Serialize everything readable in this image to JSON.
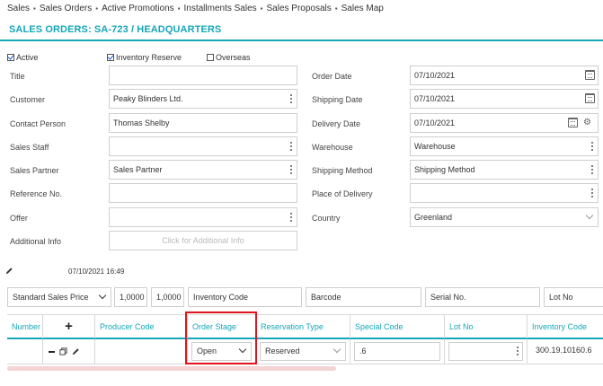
{
  "nav": {
    "items": [
      "Sales",
      "Sales Orders",
      "Active Promotions",
      "Installments Sales",
      "Sales Proposals",
      "Sales Map"
    ],
    "separator": "▪"
  },
  "page": {
    "title": "SALES ORDERS: SA-723 / HEADQUARTERS"
  },
  "checkboxes": {
    "active": {
      "label": "Active",
      "checked": true
    },
    "inventory_reserve": {
      "label": "Inventory Reserve",
      "checked": true
    },
    "overseas": {
      "label": "Overseas",
      "checked": false
    }
  },
  "left_form": {
    "title": {
      "label": "Title",
      "value": ""
    },
    "customer": {
      "label": "Customer",
      "value": "Peaky Blinders Ltd."
    },
    "contact_person": {
      "label": "Contact Person",
      "value": "Thomas Shelby"
    },
    "sales_staff": {
      "label": "Sales Staff",
      "value": ""
    },
    "sales_partner": {
      "label": "Sales Partner",
      "value": "Sales Partner"
    },
    "reference_no": {
      "label": "Reference No.",
      "value": ""
    },
    "offer": {
      "label": "Offer",
      "value": ""
    },
    "additional_info": {
      "label": "Additional Info",
      "placeholder": "Click for Additional Info"
    }
  },
  "right_form": {
    "order_date": {
      "label": "Order Date",
      "value": "07/10/2021"
    },
    "shipping_date": {
      "label": "Shipping Date",
      "value": "07/10/2021"
    },
    "delivery_date": {
      "label": "Delivery Date",
      "value": "07/10/2021"
    },
    "warehouse": {
      "label": "Warehouse",
      "value": "Warehouse"
    },
    "shipping_method": {
      "label": "Shipping Method",
      "value": "Shipping Method"
    },
    "place_of_delivery": {
      "label": "Place of Delivery",
      "value": ""
    },
    "country": {
      "label": "Country",
      "value": "Greenland"
    }
  },
  "stamp": "07/10/2021 16:49",
  "toolbar": {
    "price_list": "Standard Sales Price",
    "rate1": "1,0000",
    "rate2": "1,0000",
    "inventory_code": "Inventory Code",
    "barcode": "Barcode",
    "serial_no": "Serial No.",
    "lot_no": "Lot No"
  },
  "grid": {
    "columns": [
      "Number",
      "+",
      "Producer Code",
      "Order Stage",
      "Reservation Type",
      "Special Code",
      "Lot No",
      "Inventory Code"
    ],
    "row": {
      "number": "",
      "producer_code": "",
      "order_stage": "Open",
      "reservation_type": "Reserved",
      "special_code": ".6",
      "lot_no": "",
      "inventory_code": "300.19.10160.6"
    }
  },
  "colors": {
    "accent": "#16a7b8",
    "highlight": "#e0141e"
  }
}
